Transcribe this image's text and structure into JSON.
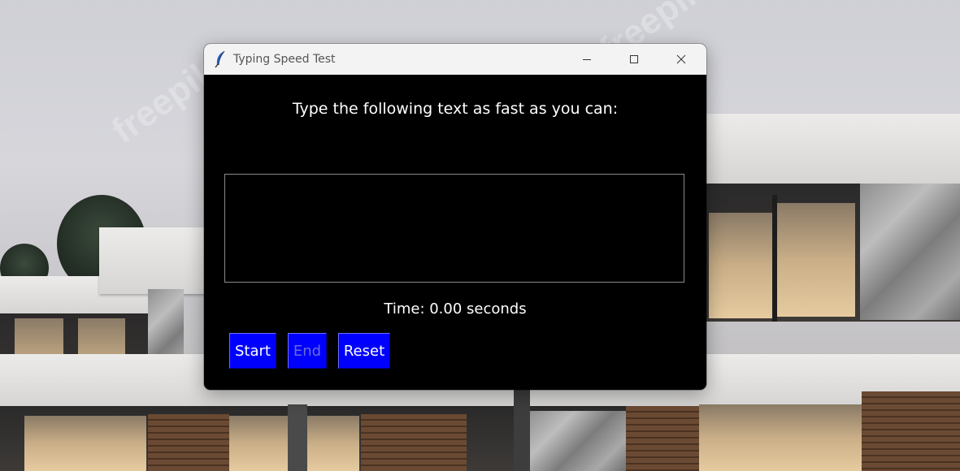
{
  "window": {
    "title": "Typing Speed Test",
    "controls": [
      "minimize",
      "maximize",
      "close"
    ]
  },
  "app": {
    "prompt": "Type the following text as fast as you can:",
    "input_text": "",
    "timer_text": "Time: 0.00 seconds",
    "buttons": {
      "start": "Start",
      "end": "End",
      "reset": "Reset"
    },
    "end_enabled": false
  },
  "icons": {
    "app": "feather-icon",
    "minimize": "minimize-icon",
    "maximize": "maximize-icon",
    "close": "close-icon"
  },
  "colors": {
    "window_bg": "#000000",
    "button_bg": "#0000ff",
    "button_text": "#ffffff",
    "disabled_text": "#6a6ad8",
    "titlebar_bg": "#f3f3f3"
  }
}
